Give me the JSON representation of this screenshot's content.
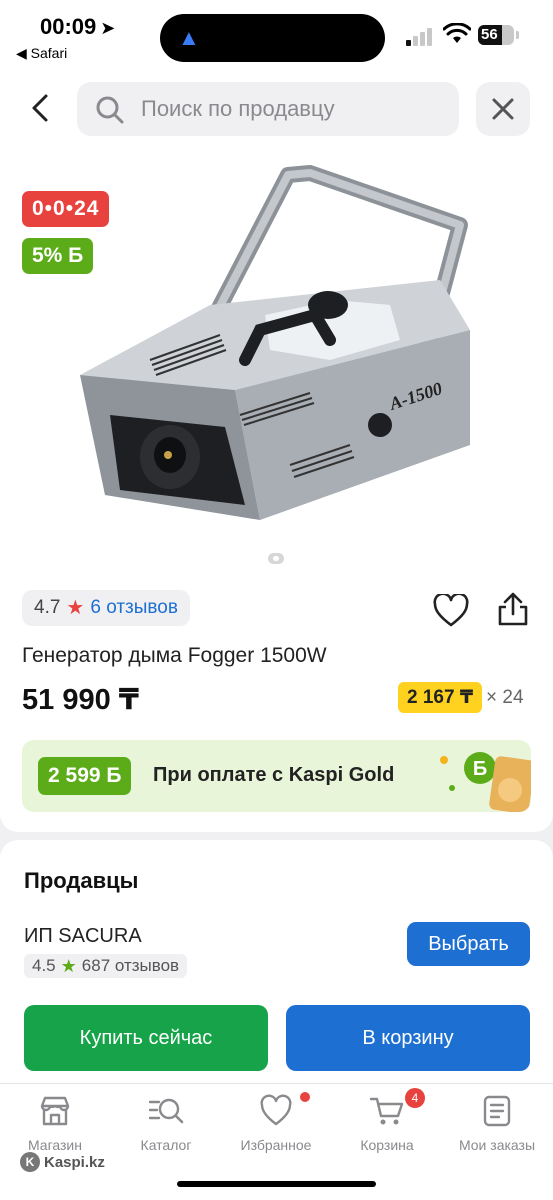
{
  "status_bar": {
    "time": "00:09",
    "back_app": "◀ Safari",
    "battery": "56"
  },
  "search": {
    "placeholder": "Поиск по продавцу"
  },
  "product": {
    "timer_badge": "0•0•24",
    "bonus_badge": "5% Б",
    "rating": "4.7",
    "reviews": "6 отзывов",
    "title": "Генератор дыма Fogger 1500W",
    "price": "51 990 ₸",
    "installment_amount": "2 167 ₸",
    "installment_months": "× 24",
    "image_label": "A-1500",
    "image_count": 1
  },
  "gold_banner": {
    "bonus": "2 599 Б",
    "text": "При оплате с Kaspi Gold"
  },
  "sellers": {
    "title": "Продавцы",
    "seller_name": "ИП SACURA",
    "seller_rating": "4.5",
    "seller_reviews": "687 отзывов",
    "choose_label": "Выбрать",
    "buy_now_label": "Купить сейчас",
    "add_to_cart_label": "В корзину"
  },
  "tabs": [
    {
      "label": "Магазин",
      "icon": "shop-icon"
    },
    {
      "label": "Каталог",
      "icon": "catalog-search-icon"
    },
    {
      "label": "Избранное",
      "icon": "heart-icon"
    },
    {
      "label": "Корзина",
      "icon": "cart-icon",
      "badge": "4"
    },
    {
      "label": "Мои заказы",
      "icon": "orders-icon"
    }
  ],
  "watermark": "Kaspi.kz",
  "colors": {
    "accent_blue": "#1d6fd1",
    "green": "#17a34a",
    "bonus_green": "#5cac1a",
    "red": "#e8423f",
    "yellow": "#ffd21f"
  }
}
